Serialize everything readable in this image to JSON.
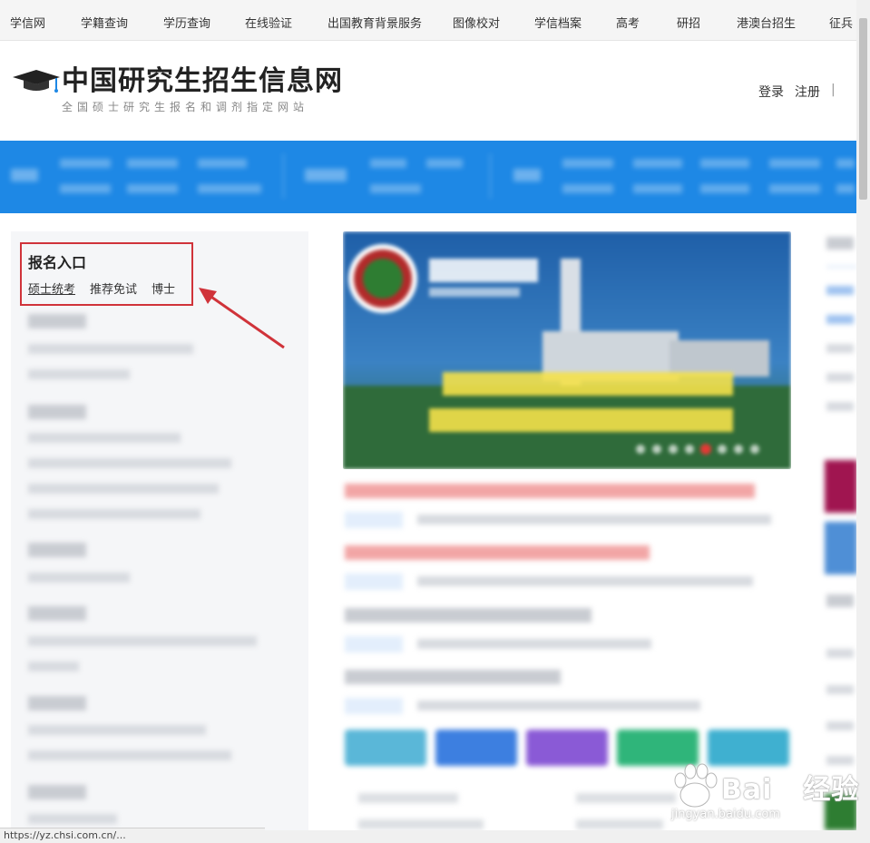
{
  "topnav": {
    "items": [
      "学信网",
      "学籍查询",
      "学历查询",
      "在线验证",
      "出国教育背景服务",
      "图像校对",
      "学信档案",
      "高考",
      "研招",
      "港澳台招生",
      "征兵"
    ]
  },
  "header": {
    "title": "中国研究生招生信息网",
    "subtitle": "全国硕士研究生报名和调剂指定网站",
    "login": "登录",
    "register": "注册",
    "separator": "|"
  },
  "entry": {
    "title": "报名入口",
    "links": [
      "硕士统考",
      "推荐免试",
      "博士"
    ]
  },
  "watermark": {
    "brand": "Bai",
    "brand2": "经验",
    "url": "jingyan.baidu.com"
  },
  "statusbar": {
    "text": "https://yz.chsi.com.cn/..."
  },
  "colors": {
    "nav_blue": "#1e88e5",
    "highlight_red": "#d0333a",
    "hot_news_red": "#e53935"
  }
}
